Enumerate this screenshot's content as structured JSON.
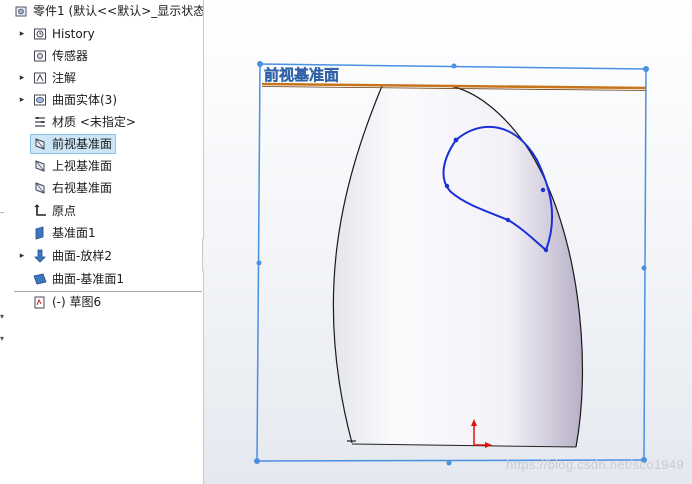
{
  "tree": {
    "root_label": "零件1 (默认<<默认>_显示状态",
    "items": [
      {
        "label": "History",
        "expand": "▸",
        "icon": "history-icon"
      },
      {
        "label": "传感器",
        "expand": "",
        "icon": "sensor-icon"
      },
      {
        "label": "注解",
        "expand": "▸",
        "icon": "annotation-icon"
      },
      {
        "label": "曲面实体(3)",
        "expand": "▸",
        "icon": "surface-bodies-icon"
      },
      {
        "label": "材质 <未指定>",
        "expand": "",
        "icon": "material-icon"
      },
      {
        "label": "前视基准面",
        "expand": "",
        "icon": "plane-icon",
        "selected": true
      },
      {
        "label": "上视基准面",
        "expand": "",
        "icon": "plane-icon"
      },
      {
        "label": "右视基准面",
        "expand": "",
        "icon": "plane-icon"
      },
      {
        "label": "原点",
        "expand": "",
        "icon": "origin-icon"
      },
      {
        "label": "基准面1",
        "expand": "",
        "icon": "plane-solid-icon"
      },
      {
        "label": "曲面-放样2",
        "expand": "▸",
        "icon": "loft-surface-icon"
      },
      {
        "label": "曲面-基准面1",
        "expand": "",
        "icon": "planar-surface-icon"
      },
      {
        "label": "(-) 草图6",
        "expand": "",
        "icon": "sketch-icon"
      }
    ]
  },
  "viewport": {
    "plane_label": "前视基准面",
    "watermark": "https://blog.csdn.net/sco1949"
  },
  "colors": {
    "selection": "#cde6f7",
    "plane_border": "#4a90e2",
    "spline": "#1a2fd6",
    "plane_edge": "#c8741a",
    "origin": "#e01010"
  }
}
